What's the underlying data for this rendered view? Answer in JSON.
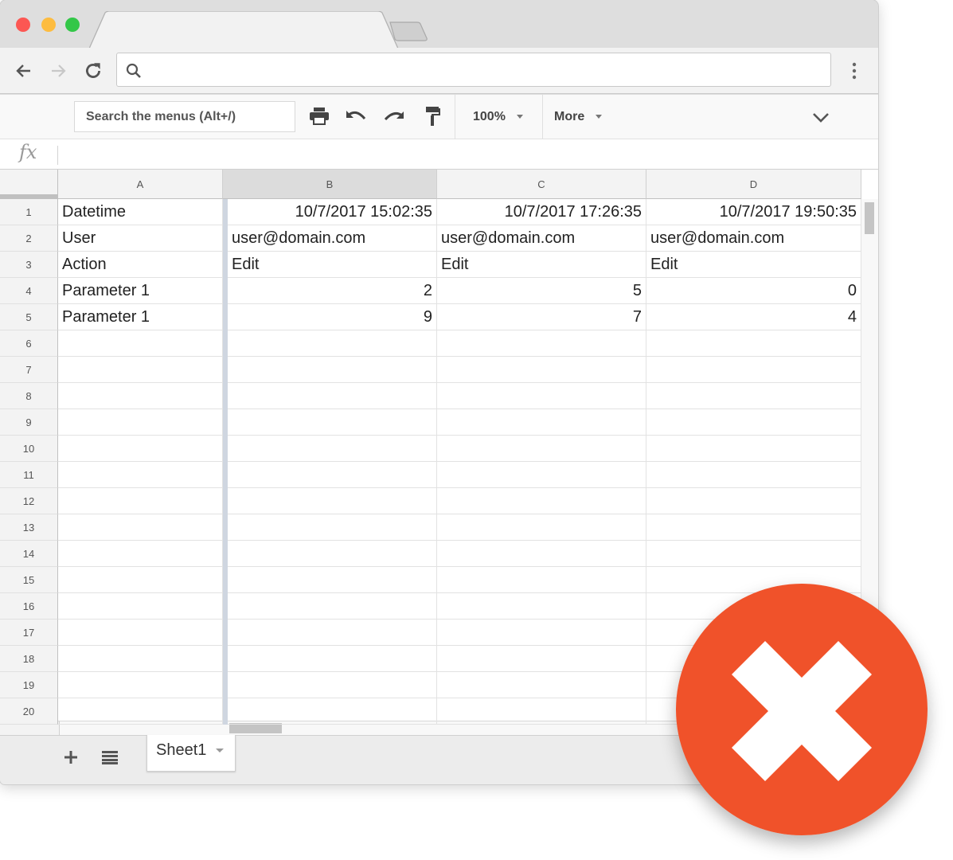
{
  "browser": {
    "traffic_lights": [
      "close",
      "minimize",
      "maximize"
    ],
    "omnibox": {
      "value": "",
      "icon": "search-icon"
    },
    "nav": {
      "back": "back-arrow-icon",
      "forward": "forward-arrow-icon",
      "reload": "reload-icon",
      "menu": "more-vert-icon"
    }
  },
  "toolbar": {
    "menu_search_placeholder": "Search the menus (Alt+/)",
    "icons": [
      "print-icon",
      "undo-icon",
      "redo-icon",
      "paint-format-icon"
    ],
    "zoom": "100%",
    "more_label": "More",
    "collapse_icon": "chevron-down-icon"
  },
  "formula_bar": {
    "label": "fx",
    "value": ""
  },
  "sheet": {
    "columns": [
      "A",
      "B",
      "C",
      "D"
    ],
    "selected_column": "B",
    "row_numbers": [
      "1",
      "2",
      "3",
      "4",
      "5",
      "6",
      "7",
      "8",
      "9",
      "10",
      "11",
      "12",
      "13",
      "14",
      "15",
      "16",
      "17",
      "18",
      "19",
      "20"
    ],
    "rows": [
      [
        "Datetime",
        "10/7/2017 15:02:35",
        "10/7/2017 17:26:35",
        "10/7/2017 19:50:35"
      ],
      [
        "User",
        "user@domain.com",
        "user@domain.com",
        "user@domain.com"
      ],
      [
        "Action",
        "Edit",
        "Edit",
        "Edit"
      ],
      [
        "Parameter 1",
        "2",
        "5",
        "0"
      ],
      [
        "Parameter 1",
        "9",
        "7",
        "4"
      ]
    ],
    "numeric_cells": [
      [
        0,
        1
      ],
      [
        0,
        2
      ],
      [
        0,
        3
      ],
      [
        3,
        1
      ],
      [
        3,
        2
      ],
      [
        3,
        3
      ],
      [
        4,
        1
      ],
      [
        4,
        2
      ],
      [
        4,
        3
      ]
    ]
  },
  "bottom": {
    "add_sheet_icon": "plus-icon",
    "all_sheets_icon": "list-icon",
    "sheet_tabs": [
      {
        "label": "Sheet1",
        "active": true
      }
    ]
  },
  "overlay": {
    "icon": "error-x-icon",
    "color": "#f0522a"
  }
}
